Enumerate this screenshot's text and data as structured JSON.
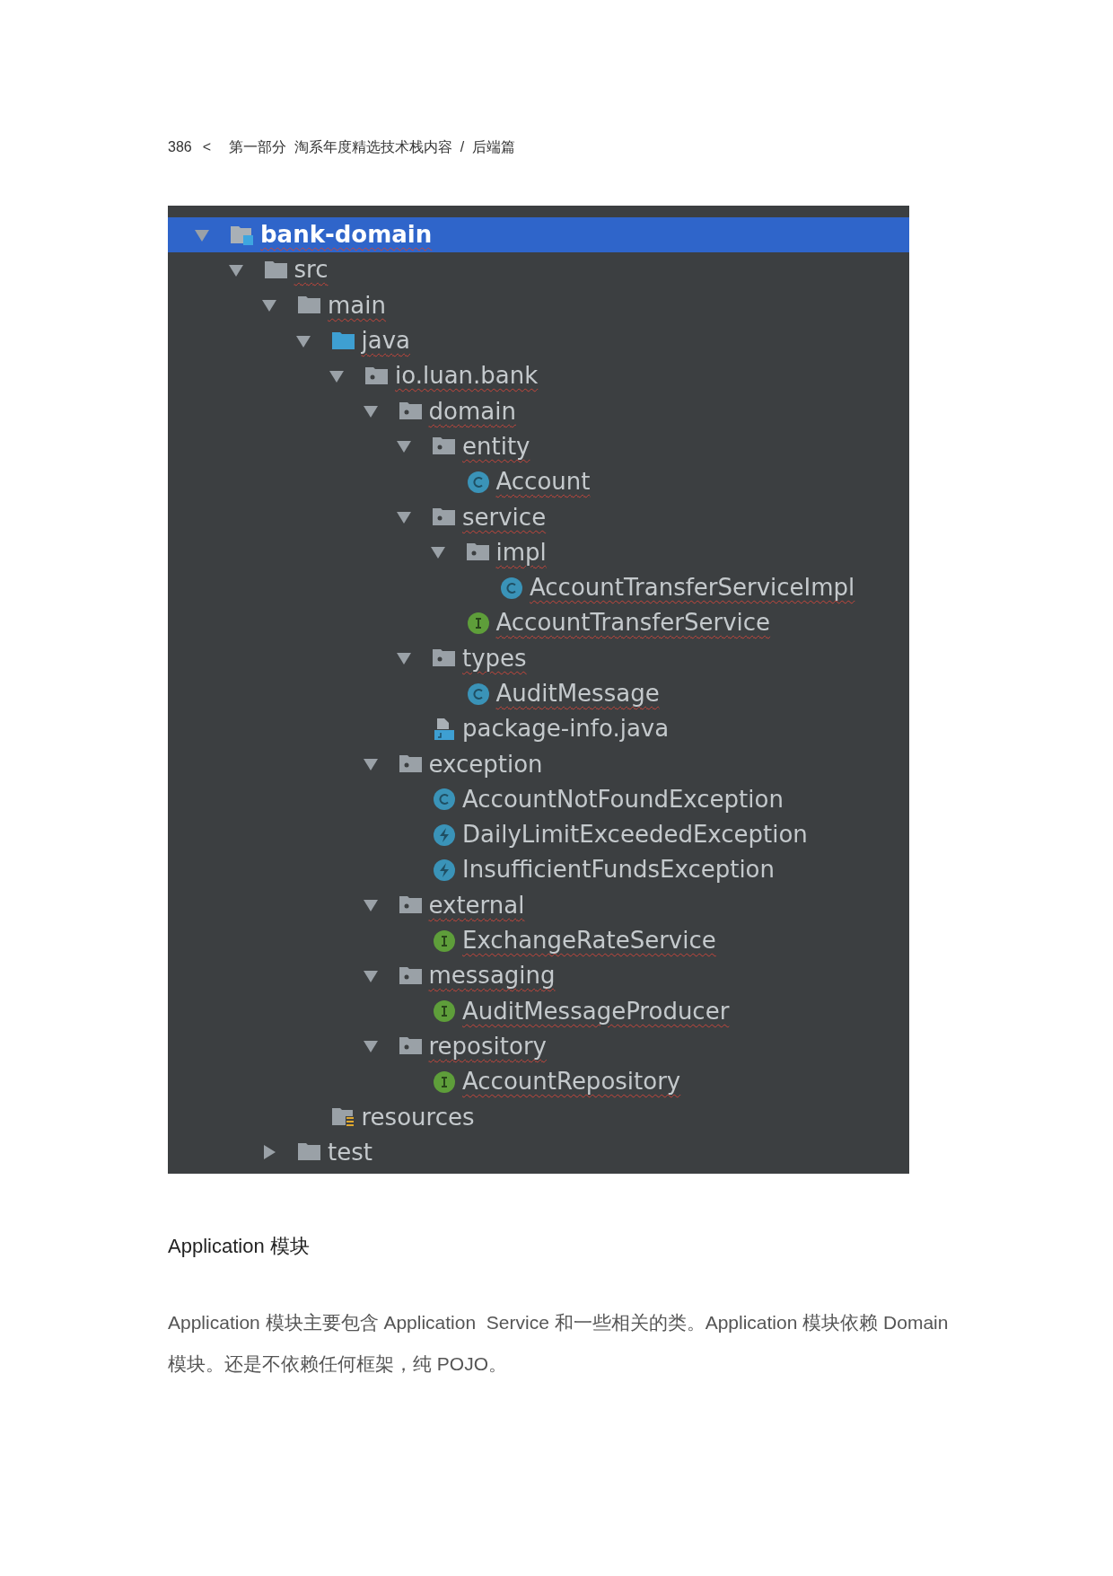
{
  "header": {
    "page_number": "386",
    "separator": "<",
    "breadcrumb": "第一部分  淘系年度精选技术栈内容  /  后端篇"
  },
  "project_tree": {
    "items": [
      {
        "label": "bank-domain",
        "kind": "module",
        "expanded": true,
        "selected": true,
        "flagged": true,
        "children": [
          {
            "label": "src",
            "kind": "folder",
            "expanded": true,
            "selected": false,
            "flagged": true,
            "children": [
              {
                "label": "main",
                "kind": "folder",
                "expanded": true,
                "selected": false,
                "flagged": true,
                "children": [
                  {
                    "label": "java",
                    "kind": "source-folder",
                    "expanded": true,
                    "selected": false,
                    "flagged": true,
                    "children": [
                      {
                        "label": "io.luan.bank",
                        "kind": "package",
                        "expanded": true,
                        "selected": false,
                        "flagged": true,
                        "children": [
                          {
                            "label": "domain",
                            "kind": "package",
                            "expanded": true,
                            "selected": false,
                            "flagged": true,
                            "children": [
                              {
                                "label": "entity",
                                "kind": "package",
                                "expanded": true,
                                "selected": false,
                                "flagged": true,
                                "children": [
                                  {
                                    "label": "Account",
                                    "kind": "class",
                                    "selected": false,
                                    "flagged": true
                                  }
                                ]
                              },
                              {
                                "label": "service",
                                "kind": "package",
                                "expanded": true,
                                "selected": false,
                                "flagged": true,
                                "children": [
                                  {
                                    "label": "impl",
                                    "kind": "package",
                                    "expanded": true,
                                    "selected": false,
                                    "flagged": true,
                                    "children": [
                                      {
                                        "label": "AccountTransferServiceImpl",
                                        "kind": "class",
                                        "selected": false,
                                        "flagged": true
                                      }
                                    ]
                                  },
                                  {
                                    "label": "AccountTransferService",
                                    "kind": "interface",
                                    "selected": false,
                                    "flagged": true
                                  }
                                ]
                              },
                              {
                                "label": "types",
                                "kind": "package",
                                "expanded": true,
                                "selected": false,
                                "flagged": true,
                                "children": [
                                  {
                                    "label": "AuditMessage",
                                    "kind": "class",
                                    "selected": false,
                                    "flagged": true
                                  }
                                ]
                              },
                              {
                                "label": "package-info.java",
                                "kind": "java-file",
                                "selected": false,
                                "flagged": false
                              }
                            ]
                          },
                          {
                            "label": "exception",
                            "kind": "package",
                            "expanded": true,
                            "selected": false,
                            "flagged": false,
                            "children": [
                              {
                                "label": "AccountNotFoundException",
                                "kind": "class",
                                "selected": false,
                                "flagged": false
                              },
                              {
                                "label": "DailyLimitExceededException",
                                "kind": "exception",
                                "selected": false,
                                "flagged": false
                              },
                              {
                                "label": "InsufficientFundsException",
                                "kind": "exception",
                                "selected": false,
                                "flagged": false
                              }
                            ]
                          },
                          {
                            "label": "external",
                            "kind": "package",
                            "expanded": true,
                            "selected": false,
                            "flagged": true,
                            "children": [
                              {
                                "label": "ExchangeRateService",
                                "kind": "interface",
                                "selected": false,
                                "flagged": true
                              }
                            ]
                          },
                          {
                            "label": "messaging",
                            "kind": "package",
                            "expanded": true,
                            "selected": false,
                            "flagged": true,
                            "children": [
                              {
                                "label": "AuditMessageProducer",
                                "kind": "interface",
                                "selected": false,
                                "flagged": true
                              }
                            ]
                          },
                          {
                            "label": "repository",
                            "kind": "package",
                            "expanded": true,
                            "selected": false,
                            "flagged": true,
                            "children": [
                              {
                                "label": "AccountRepository",
                                "kind": "interface",
                                "selected": false,
                                "flagged": true
                              }
                            ]
                          }
                        ]
                      }
                    ]
                  },
                  {
                    "label": "resources",
                    "kind": "resources-folder",
                    "selected": false,
                    "flagged": false
                  }
                ]
              },
              {
                "label": "test",
                "kind": "folder",
                "expanded": false,
                "selected": false,
                "flagged": false
              }
            ]
          }
        ]
      }
    ]
  },
  "section_heading": "Application 模块",
  "paragraph": "Application 模块主要包含 Application  Service 和一些相关的类。Application 模块依赖 Domain 模块。还是不依赖任何框架，纯 POJO。"
}
